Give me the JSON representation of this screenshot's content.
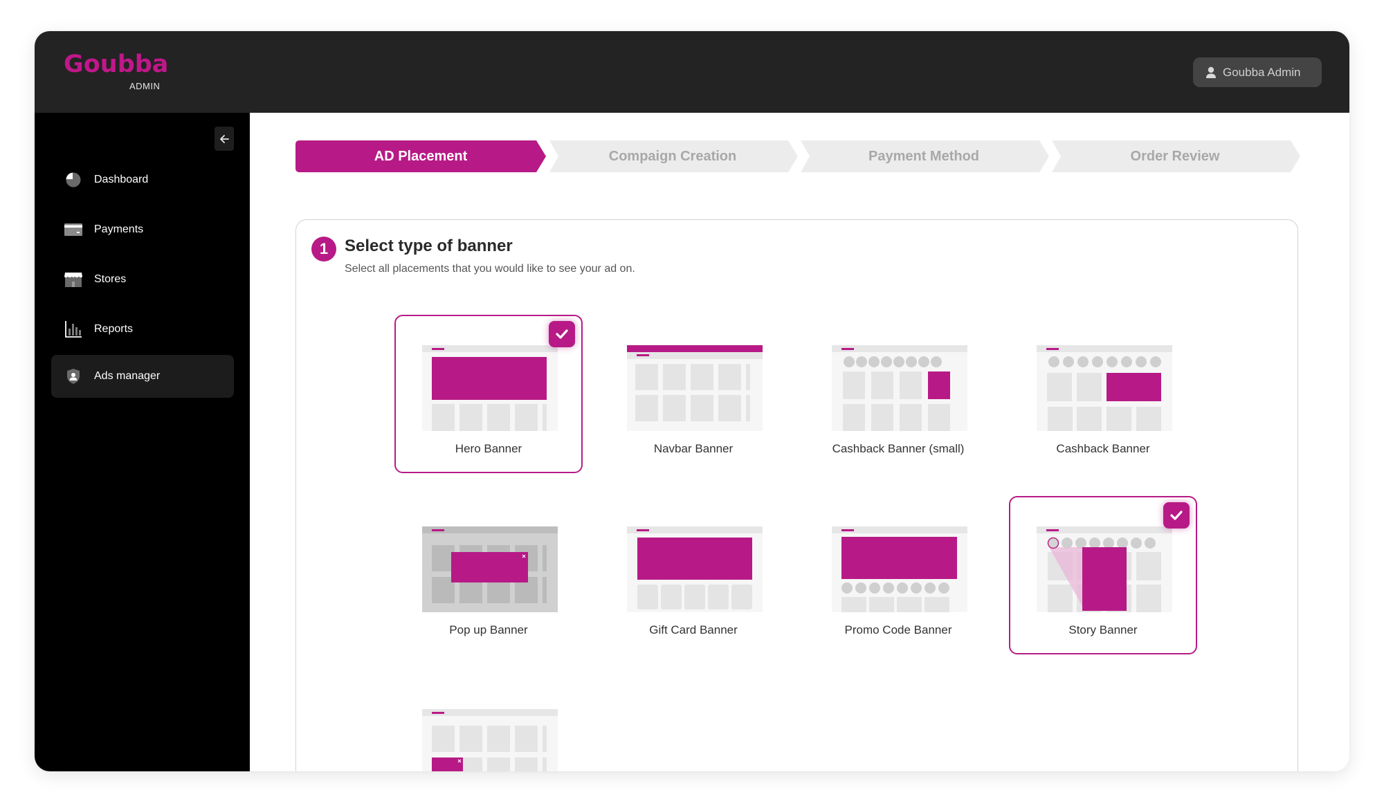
{
  "brand": {
    "logo_text": "Goubba",
    "logo_sub": "ADMIN",
    "accent": "#b71a86"
  },
  "header": {
    "user_label": "Goubba Admin",
    "user_icon": "user-icon"
  },
  "sidebar": {
    "collapse_icon": "arrow-left-icon",
    "items": [
      {
        "label": "Dashboard",
        "icon": "pie-chart-icon",
        "active": false
      },
      {
        "label": "Payments",
        "icon": "credit-card-icon",
        "active": false
      },
      {
        "label": "Stores",
        "icon": "store-icon",
        "active": false
      },
      {
        "label": "Reports",
        "icon": "bar-chart-icon",
        "active": false
      },
      {
        "label": "Ads manager",
        "icon": "shield-user-icon",
        "active": true
      }
    ]
  },
  "stepper": {
    "steps": [
      {
        "label": "AD Placement",
        "active": true
      },
      {
        "label": "Compaign Creation",
        "active": false
      },
      {
        "label": "Payment Method",
        "active": false
      },
      {
        "label": "Order Review",
        "active": false
      }
    ]
  },
  "section": {
    "number": "1",
    "title": "Select type of banner",
    "subtitle": "Select all placements that you would like to see your ad on."
  },
  "banners": [
    {
      "label": "Hero Banner",
      "type": "hero",
      "selected": true
    },
    {
      "label": "Navbar Banner",
      "type": "navbar",
      "selected": false
    },
    {
      "label": "Cashback Banner (small)",
      "type": "cashback-small",
      "selected": false
    },
    {
      "label": "Cashback Banner",
      "type": "cashback",
      "selected": false
    },
    {
      "label": "Pop up Banner",
      "type": "popup",
      "selected": false
    },
    {
      "label": "Gift Card Banner",
      "type": "giftcard",
      "selected": false
    },
    {
      "label": "Promo Code Banner",
      "type": "promo",
      "selected": false
    },
    {
      "label": "Story Banner",
      "type": "story",
      "selected": true
    },
    {
      "label": "",
      "type": "corner-popup",
      "selected": false
    }
  ]
}
